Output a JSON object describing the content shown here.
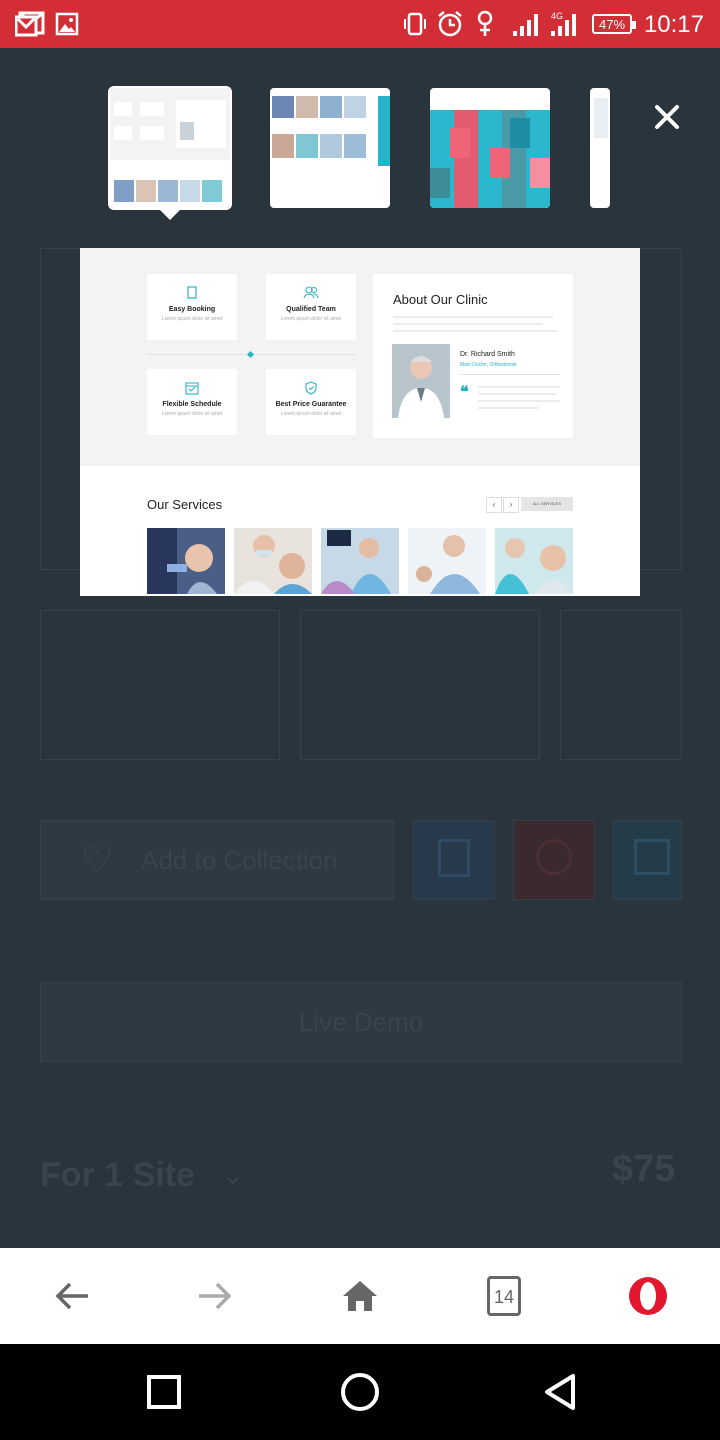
{
  "status_bar": {
    "time": "10:17",
    "battery": "47%",
    "network": "4G",
    "background_color": "#d32d36",
    "icons": [
      "gmail-icon",
      "gallery-icon",
      "vibrate-icon",
      "alarm-icon",
      "female-icon",
      "signal-icon",
      "signal-4g-icon",
      "battery-icon"
    ]
  },
  "tab_switcher": {
    "tabs": [
      {
        "name": "tab-thumb-dental-about",
        "active": true
      },
      {
        "name": "tab-thumb-dental-gallery",
        "active": false
      },
      {
        "name": "tab-thumb-color-grid",
        "active": false
      },
      {
        "name": "tab-thumb-partial",
        "active": false
      }
    ],
    "close_icon": "close-icon"
  },
  "preview": {
    "features": [
      {
        "icon": "book-icon",
        "title": "Easy Booking",
        "subtitle": "Lorem ipsum dolor sit amet"
      },
      {
        "icon": "team-icon",
        "title": "Qualified Team",
        "subtitle": "Lorem ipsum dolor sit amet"
      },
      {
        "icon": "calendar-icon",
        "title": "Flexible Schedule",
        "subtitle": "Lorem ipsum dolor sit amet"
      },
      {
        "icon": "shield-icon",
        "title": "Best Price Guarantee",
        "subtitle": "Lorem ipsum dolor sit amet"
      }
    ],
    "about": {
      "title": "About Our Clinic",
      "doctor_name": "Dr. Richard Smith",
      "doctor_role": "Main Doctor, Orthodontist"
    },
    "services": {
      "title": "Our Services",
      "prev": "‹",
      "next": "›",
      "all_label": "ALL SERVICES"
    },
    "accent_color": "#28b4c8"
  },
  "background_page": {
    "add_to_collection": "Add to Collection",
    "live_demo": "Live Demo",
    "license": "For 1 Site",
    "price": "$75"
  },
  "browser_bar": {
    "back_icon": "back-arrow-icon",
    "forward_icon": "forward-arrow-icon",
    "home_icon": "home-icon",
    "tab_count": "14",
    "opera_icon": "opera-icon"
  },
  "android_nav": [
    "recents-icon",
    "home-circle-icon",
    "back-triangle-icon"
  ]
}
